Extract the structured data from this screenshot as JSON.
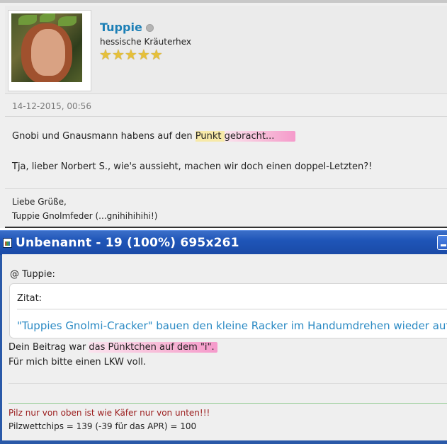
{
  "post": {
    "username": "Tuppie",
    "user_title": "hessische Kräuterhex",
    "stars": [
      "★",
      "★",
      "★",
      "★",
      "★"
    ],
    "date": "14-12-2015, 00:56",
    "line1_before": "Gnobi und Gnausmann habens auf den ",
    "line1_highlight_a": "Punkt ",
    "line1_highlight_b": "gebracht...",
    "line2": "Tja, lieber Norbert S., wie's aussieht, machen wir doch einen doppel-Letzten?!",
    "sig_line1": "Liebe Grüße,",
    "sig_line2": "Tuppie Gnolmfeder (...gnihihihihi!)"
  },
  "window": {
    "title": "Unbenannt - 19 (100%) 695x261",
    "app_icon": "image-editor-icon",
    "minimize_icon": "minimize-icon",
    "mention": "@ Tuppie:",
    "quote_label": "Zitat:",
    "quote_text": "\"Tuppies Gnolmi-Cracker\" bauen den kleine Racker im Handumdrehen wieder auf!",
    "reply_before": "Dein Beitrag war ",
    "reply_highlight": "das Pünktchen auf dem \"i\".",
    "reply_line2": "Für mich bitte einen LKW voll.",
    "sig_red": "Pilz nur von oben ist wie Käfer nur von unten!!!",
    "sig_chips": "Pilzwettchips = 139 (-39 für das APR) = 100"
  },
  "colors": {
    "username": "#1c7fb6",
    "quote_text": "#2b8ac4",
    "titlebar": "#1f55b8",
    "sig_red": "#9a1b1b",
    "highlight_pink": "#f59acb",
    "highlight_yellow": "#f7e9a8",
    "star": "#e6c03a"
  }
}
